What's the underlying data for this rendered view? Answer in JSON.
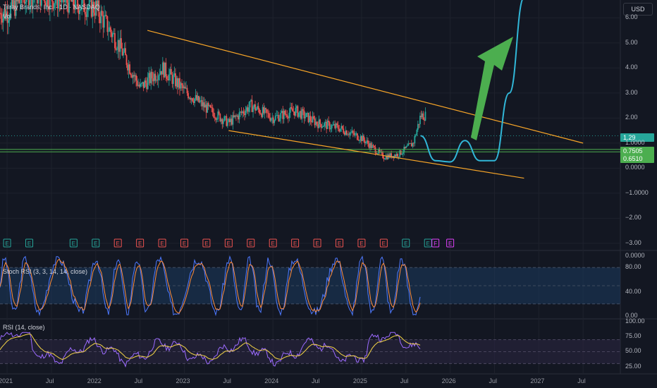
{
  "header": {
    "symbol_title": "Tilray Brands, Inc. · 1D · NASDAQ",
    "volume_label": "Vol",
    "currency": "USD"
  },
  "price_tags": {
    "last_price": "1.29",
    "green_level_1": "0.7505",
    "green_level_2": "0.6510"
  },
  "colors": {
    "background": "#131722",
    "grid": "#1e222d",
    "channel_line": "#f7a528",
    "projection_line": "#31b7d8",
    "arrow": "#4cae4f",
    "support_line": "#4cae4f",
    "candle_up": "#26a69a",
    "candle_down": "#ef5350",
    "stoch_k": "#4d79ff",
    "stoch_d": "#ff8c3a",
    "rsi_line": "#9c6bff",
    "rsi_ma": "#f5d547",
    "earnings_past": "#26a69a",
    "earnings_neg": "#ef5350",
    "earnings_future": "#e040fb"
  },
  "indicators": {
    "stoch_label": "Stoch RSI (3, 3, 14, 14, close)",
    "rsi_label": "RSI (14, close)"
  },
  "chart_data": [
    {
      "type": "line",
      "title": "",
      "note": "price candles (daily) with descending channel, projected path and up arrow",
      "y_axis_ticks": [
        "6.00",
        "5.00",
        "4.00",
        "3.00",
        "2.00",
        "1.0000",
        "0.0000",
        "−1.0000",
        "−2.00",
        "−3.00"
      ],
      "ylim": [
        -3.2,
        6.6
      ],
      "x_axis_ticks": [
        "2021",
        "Jul",
        "2022",
        "Jul",
        "2023",
        "Jul",
        "2024",
        "Jul",
        "2025",
        "Jul",
        "2026",
        "Jul",
        "2027",
        "Jul"
      ],
      "series": [
        {
          "role": "close",
          "x": [
            "2021-01",
            "2021-04",
            "2021-07",
            "2021-10",
            "2022-01",
            "2022-04",
            "2022-07",
            "2022-10",
            "2023-01",
            "2023-04",
            "2023-07",
            "2023-10",
            "2024-01",
            "2024-04",
            "2024-07",
            "2024-10",
            "2025-01",
            "2025-04",
            "2025-06",
            "2025-08",
            "2025-09"
          ],
          "values": [
            6.2,
            7.0,
            6.8,
            6.6,
            6.4,
            5.0,
            3.2,
            4.0,
            3.1,
            2.4,
            1.8,
            2.5,
            2.0,
            2.3,
            1.8,
            1.6,
            1.2,
            0.45,
            0.55,
            1.0,
            2.1
          ]
        },
        {
          "role": "projection",
          "x": [
            "2025-09",
            "2025-11",
            "2026-01",
            "2026-03",
            "2026-05",
            "2026-07",
            "2026-09",
            "2026-11"
          ],
          "values": [
            1.29,
            0.3,
            0.25,
            1.1,
            0.3,
            0.3,
            3.0,
            6.8
          ]
        }
      ],
      "channel_upper": {
        "x": [
          "2022-08",
          "2027-07"
        ],
        "values": [
          5.5,
          1.0
        ]
      },
      "channel_lower": {
        "x": [
          "2023-07",
          "2026-11"
        ],
        "values": [
          1.5,
          -0.4
        ]
      },
      "support_levels": [
        0.7505,
        0.651
      ],
      "earnings_markers": [
        "E",
        "E",
        "E",
        "E",
        "E",
        "E",
        "E",
        "E",
        "E",
        "E",
        "E",
        "E",
        "E",
        "E",
        "E",
        "E",
        "E",
        "E",
        "E",
        "F",
        "E"
      ],
      "earnings_x": [
        "2021-01",
        "2021-04",
        "2021-10",
        "2022-01",
        "2022-04",
        "2022-07",
        "2022-10",
        "2023-01",
        "2023-04",
        "2023-07",
        "2023-10",
        "2024-01",
        "2024-04",
        "2024-07",
        "2024-10",
        "2025-01",
        "2025-04",
        "2025-07",
        "2025-10",
        "2025-11",
        "2026-01"
      ]
    },
    {
      "type": "line",
      "title": "Stoch RSI (3, 3, 14, 14, close)",
      "y_axis_ticks": [
        "80.00",
        "40.00",
        "0.00"
      ],
      "ylim": [
        0,
        100
      ],
      "bands": [
        20,
        80
      ]
    },
    {
      "type": "line",
      "title": "RSI (14, close)",
      "y_axis_ticks": [
        "100.00",
        "75.00",
        "50.00",
        "25.00"
      ],
      "ylim": [
        15,
        100
      ],
      "bands": [
        30,
        70
      ]
    }
  ]
}
